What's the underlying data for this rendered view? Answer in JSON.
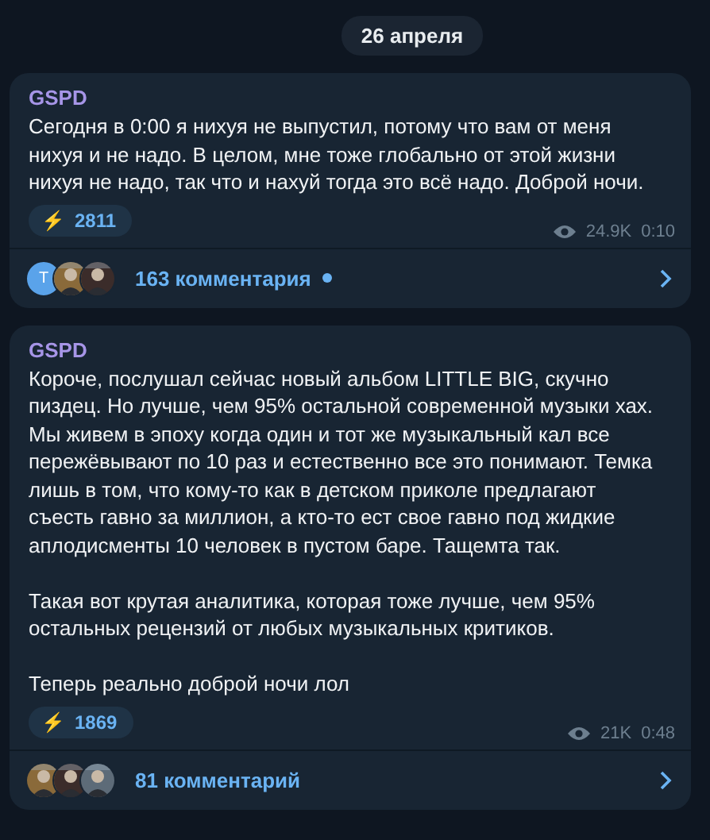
{
  "date_pill": "26 апреля",
  "posts": [
    {
      "author": "GSPD",
      "paragraphs": [
        "Сегодня в 0:00 я нихуя не выпустил, потому что вам от меня\nнихуя и не надо. В целом, мне тоже глобально от этой жизни\nнихуя не надо, так что и нахуй тогда это всё надо. Доброй ночи."
      ],
      "reaction": {
        "emoji": "⚡",
        "count": "2811"
      },
      "views": "24.9K",
      "time": "0:10",
      "comments": {
        "label": "163 комментария",
        "unread": true,
        "avatars": [
          {
            "kind": "letter",
            "letter": "T"
          },
          {
            "kind": "picture"
          },
          {
            "kind": "picture"
          }
        ]
      }
    },
    {
      "author": "GSPD",
      "paragraphs": [
        "Короче, послушал сейчас новый альбом LITTLE BIG, скучно\nпиздец. Но лучше, чем 95% остальной современной музыки хах.\nМы живем в эпоху когда один и тот же музыкальный кал все\nпережёвывают по 10 раз и естественно все это понимают.  Темка\nлишь в том, что кому-то как в детском приколе предлагают\nсъесть гавно за миллион, а кто-то ест свое гавно под жидкие\nаплодисменты 10 человек в пустом баре. Тащемта так.",
        "Такая вот крутая аналитика, которая тоже лучше, чем 95%\nостальных рецензий от любых музыкальных критиков.",
        "Теперь реально доброй ночи лол"
      ],
      "reaction": {
        "emoji": "⚡",
        "count": "1869"
      },
      "views": "21K",
      "time": "0:48",
      "comments": {
        "label": "81 комментарий",
        "unread": false,
        "avatars": [
          {
            "kind": "picture"
          },
          {
            "kind": "picture"
          },
          {
            "kind": "picture"
          }
        ]
      }
    }
  ]
}
